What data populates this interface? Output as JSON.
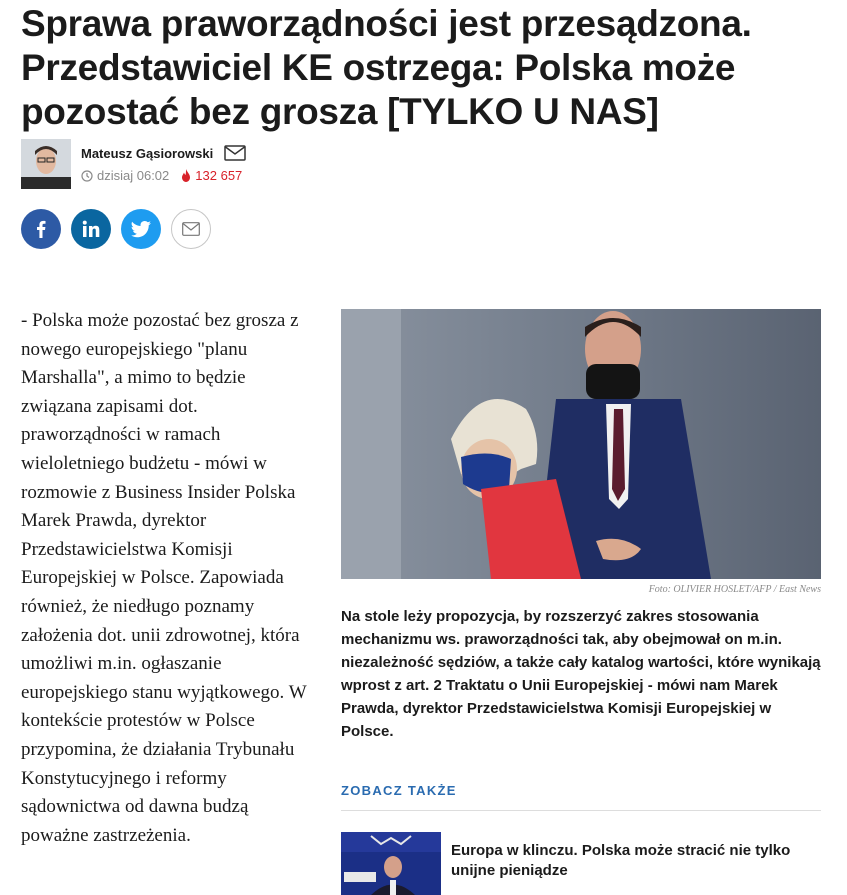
{
  "article": {
    "headline": "Sprawa praworządności jest przesądzona. Przedstawiciel KE ostrzega: Polska może pozostać bez grosza [TYLKO U NAS]",
    "author": "Mateusz Gąsiorowski",
    "time": "dzisiaj 06:02",
    "views": "132 657",
    "lead": "- Polska może pozostać bez grosza z nowego europejskiego \"planu Marshalla\", a mimo to będzie związana zapisami dot. praworządności w ramach wieloletniego budżetu - mówi w rozmowie z Business Insider Polska Marek Prawda, dyrektor Przedstawicielstwa Komisji Europejskiej w Polsce. Zapowiada również, że niedługo poznamy założenia dot. unii zdrowotnej, która umożliwi m.in. ogłaszanie europejskiego stanu wyjątkowego. W kontekście protestów w Polsce przypomina, że działania Trybunału Konstytucyjnego i reformy sądownictwa od dawna budzą poważne zastrzeżenia.",
    "photo_credit": "Foto: OLIVIER HOSLET/AFP / East News",
    "caption": "Na stole leży propozycja, by rozszerzyć zakres stosowania mechanizmu ws. praworządności tak, aby obejmował on m.in. niezależność sędziów, a także cały katalog wartości, które wynikają wprost z art. 2 Traktatu o Unii Europejskiej - mówi nam Marek Prawda, dyrektor Przedstawicielstwa Komisji Europejskiej w Polsce."
  },
  "share": {
    "icons": [
      "facebook-icon",
      "linkedin-icon",
      "twitter-icon",
      "email-icon"
    ],
    "colors": {
      "facebook": "#2d5aa5",
      "linkedin": "#0a66a0",
      "twitter": "#1e9cf0"
    }
  },
  "related": {
    "heading": "ZOBACZ TAKŻE",
    "title": "Europa w klinczu. Polska może stracić nie tylko unijne pieniądze"
  },
  "colors": {
    "accent": "#2a6bb0",
    "views": "#d8222a"
  }
}
